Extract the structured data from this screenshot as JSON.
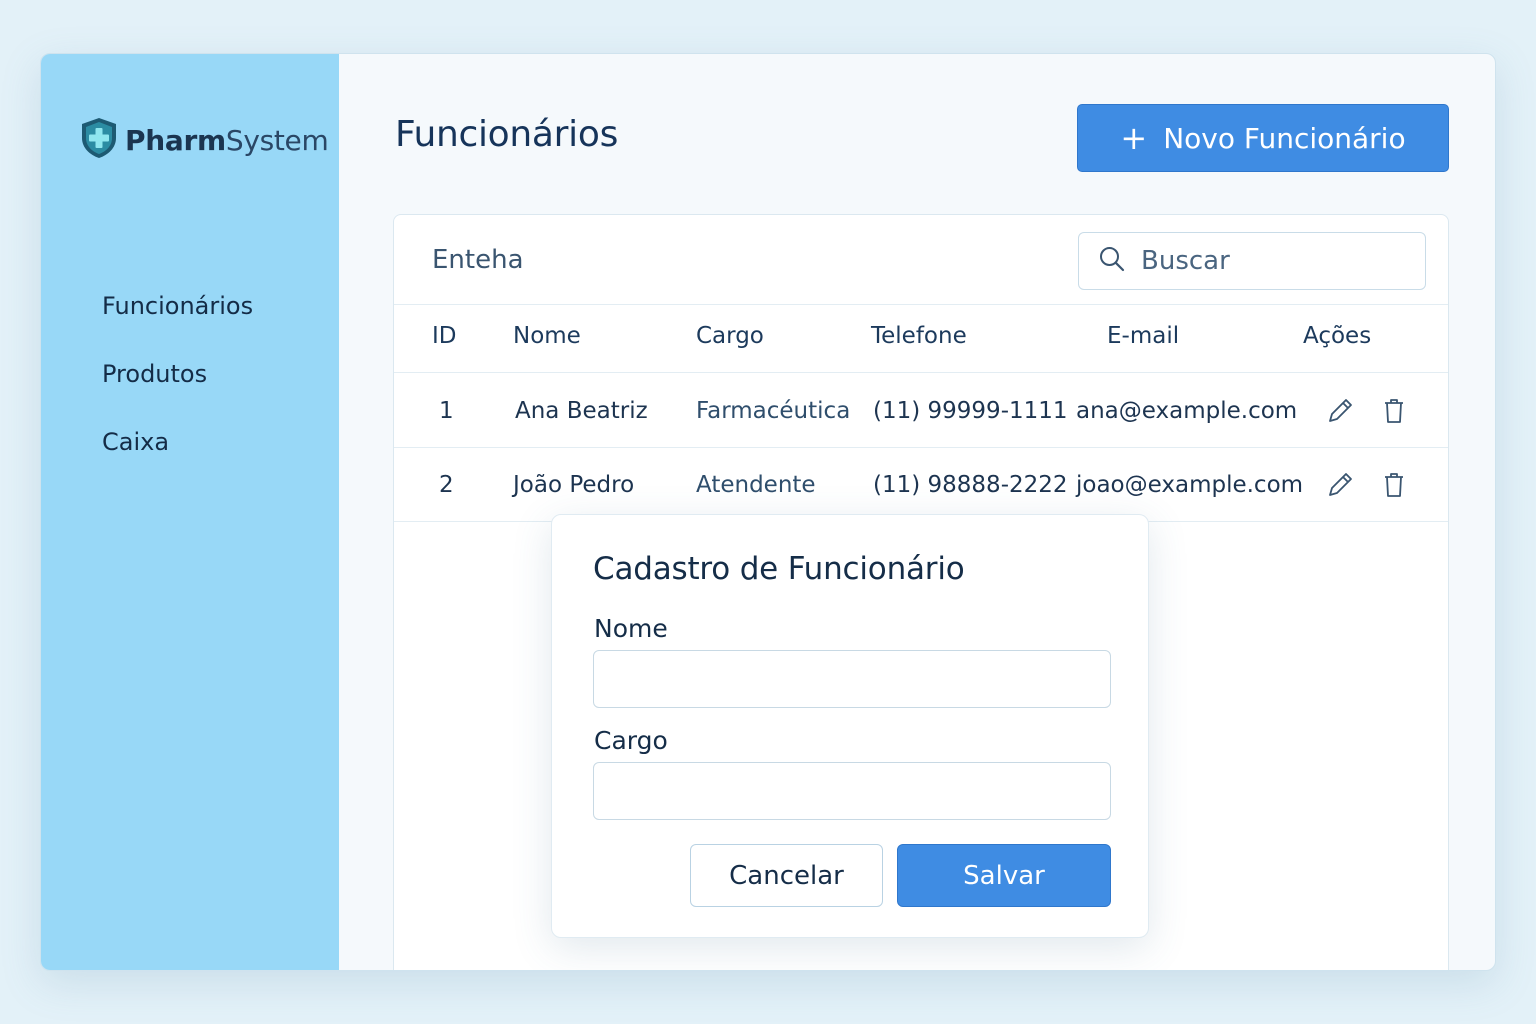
{
  "app": {
    "logo_bold": "Pharm",
    "logo_light": "System",
    "logo_icon": "medical-shield-icon"
  },
  "sidebar": {
    "items": [
      {
        "label": "Funcionários"
      },
      {
        "label": "Produtos"
      },
      {
        "label": "Caixa"
      }
    ]
  },
  "header": {
    "title": "Funcionários",
    "new_button_icon": "+",
    "new_button_label": "Novo Funcionário"
  },
  "table_card": {
    "title": "Enteha",
    "search_placeholder": "Buscar",
    "columns": [
      "ID",
      "Nome",
      "Cargo",
      "Telefone",
      "E-mail",
      "Ações"
    ],
    "rows": [
      {
        "id": "1",
        "nome": "Ana Beatriz",
        "cargo": "Farmacéutica",
        "telefone": "(11) 99999-1111",
        "email": "ana@example.com"
      },
      {
        "id": "2",
        "nome": "João Pedro",
        "cargo": "Atendente",
        "telefone": "(11) 98888-2222",
        "email": "joao@example.com"
      }
    ],
    "row_actions": [
      "edit-icon",
      "trash-icon"
    ]
  },
  "modal": {
    "title": "Cadastro de Funcionário",
    "fields": [
      {
        "label": "Nome",
        "value": ""
      },
      {
        "label": "Cargo",
        "value": ""
      }
    ],
    "cancel_label": "Cancelar",
    "save_label": "Salvar"
  },
  "colors": {
    "sidebar": "#98d8f7",
    "primary": "#3f8ce3",
    "text_dark": "#16324f",
    "logo_shield": "#1d5a73",
    "logo_cross": "#5ccfe0"
  }
}
